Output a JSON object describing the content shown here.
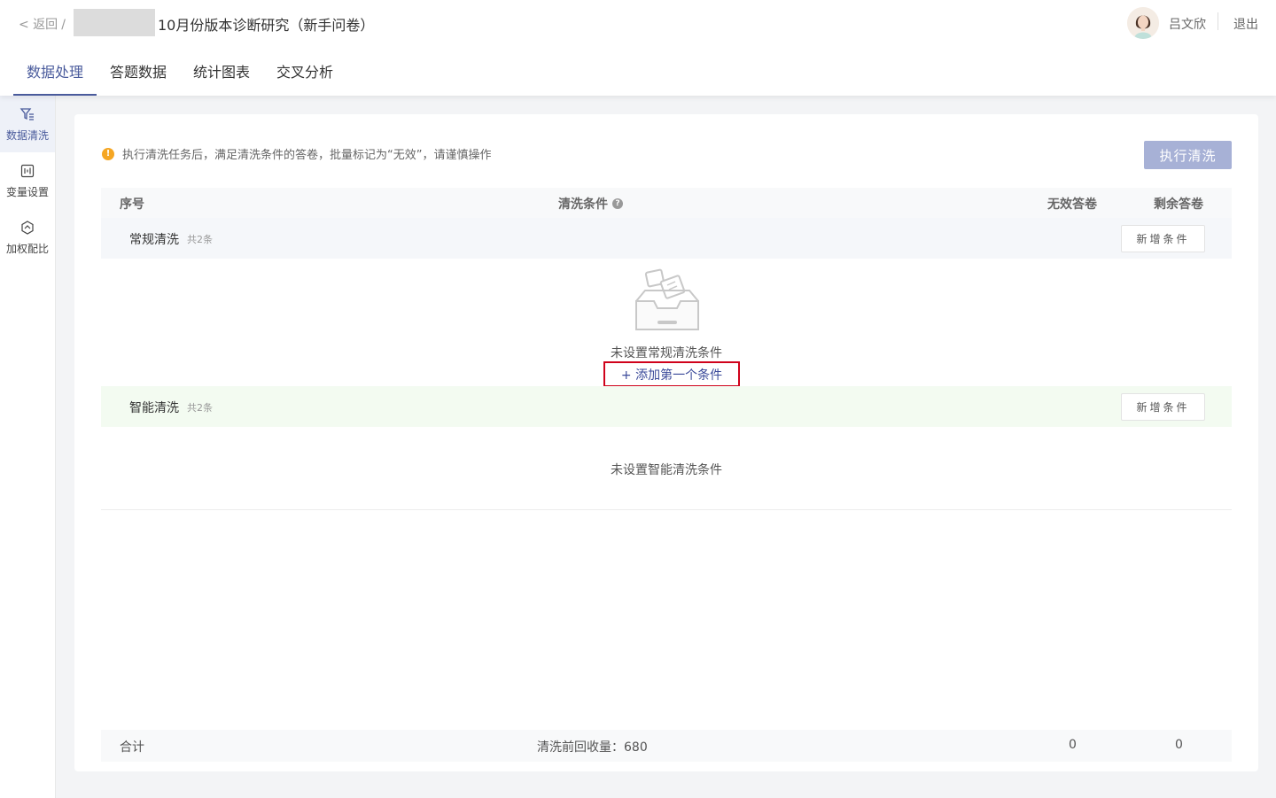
{
  "header": {
    "back_label": "< 返回",
    "slash": "/",
    "survey_title": "10月份版本诊断研究（新手问卷）",
    "username": "吕文欣",
    "logout_label": "退出"
  },
  "tabs": [
    {
      "label": "数据处理",
      "active": true
    },
    {
      "label": "答题数据",
      "active": false
    },
    {
      "label": "统计图表",
      "active": false
    },
    {
      "label": "交叉分析",
      "active": false
    }
  ],
  "sidenav": [
    {
      "label": "数据清洗",
      "icon": "filter-icon",
      "active": true
    },
    {
      "label": "变量设置",
      "icon": "variable-icon",
      "active": false
    },
    {
      "label": "加权配比",
      "icon": "weight-icon",
      "active": false
    }
  ],
  "notice": {
    "icon": "warning-icon",
    "text": "执行清洗任务后，满足清洗条件的答卷，批量标记为“无效”，请谨慎操作"
  },
  "execute_button": "执行清洗",
  "table": {
    "headers": [
      "序号",
      "清洗条件",
      "无效答卷",
      "剩余答卷"
    ],
    "groups": [
      {
        "name": "常规清洗",
        "count": "共2条",
        "add_button": "新增条件",
        "empty_text": "未设置常规清洗条件",
        "add_first_label": "+ 添加第一个条件"
      },
      {
        "name": "智能清洗",
        "count": "共2条",
        "add_button": "新增条件",
        "empty_text": "未设置智能清洗条件"
      }
    ],
    "footer": {
      "label": "合计",
      "collected": "清洗前回收量：680",
      "invalid": "0",
      "remaining": "0"
    }
  },
  "colors": {
    "accent": "#4a5b9c",
    "execute_button_bg": "#a7b1d6",
    "highlight_border": "#d0021b",
    "warning": "#f5a623"
  }
}
